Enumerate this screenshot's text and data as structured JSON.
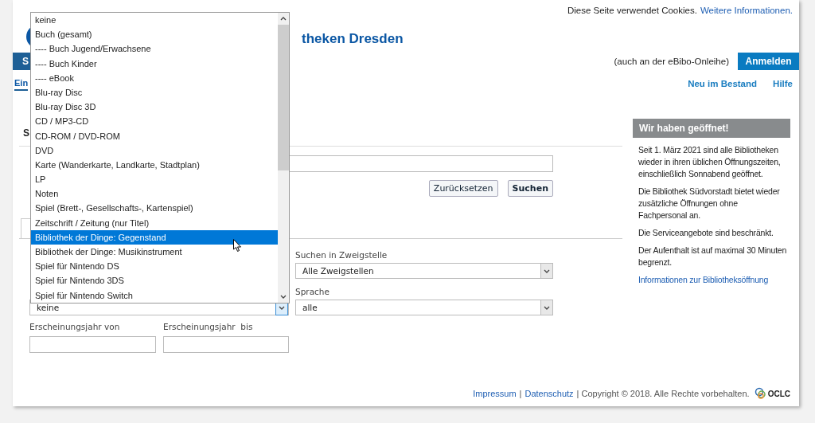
{
  "cookie_notice": {
    "text": "Diese Seite verwendet Cookies.",
    "link": "Weitere Informationen."
  },
  "site_title": "theken Dresden",
  "nav_tab": {
    "label": "S",
    "selected": true
  },
  "login_hint": "(auch an der eBibo-Onleihe)",
  "login_button": "Anmelden",
  "sub_tab": {
    "label": "Ein",
    "selected": true
  },
  "header_links": [
    "Neu im Bestand",
    "Hilfe"
  ],
  "section_heading": "S",
  "buttons": [
    {
      "label": "Zurücksetzen",
      "primary": false
    },
    {
      "label": "Suchen",
      "primary": true
    }
  ],
  "filters": [
    {
      "label": "Suchen in Zweigstelle",
      "value": "Alle Zweigstellen"
    },
    {
      "label": "Sprache",
      "value": "alle"
    }
  ],
  "media_select": {
    "value": "keine",
    "focused": true
  },
  "year_fields": [
    {
      "label": "Erscheinungsjahr von"
    },
    {
      "label": "Erscheinungsjahr  bis"
    }
  ],
  "dropdown_list": {
    "options": [
      {
        "label": "keine",
        "selected": false
      },
      {
        "label": "Buch (gesamt)",
        "selected": false
      },
      {
        "label": "---- Buch Jugend/Erwachsene",
        "selected": false
      },
      {
        "label": "---- Buch Kinder",
        "selected": false
      },
      {
        "label": "---- eBook",
        "selected": false
      },
      {
        "label": "Blu-ray Disc",
        "selected": false
      },
      {
        "label": "Blu-ray Disc 3D",
        "selected": false
      },
      {
        "label": "CD / MP3-CD",
        "selected": false
      },
      {
        "label": "CD-ROM / DVD-ROM",
        "selected": false
      },
      {
        "label": "DVD",
        "selected": false
      },
      {
        "label": "Karte (Wanderkarte, Landkarte, Stadtplan)",
        "selected": false
      },
      {
        "label": "LP",
        "selected": false
      },
      {
        "label": "Noten",
        "selected": false
      },
      {
        "label": "Spiel (Brett-, Gesellschafts-, Kartenspiel)",
        "selected": false
      },
      {
        "label": "Zeitschrift / Zeitung (nur Titel)",
        "selected": false
      },
      {
        "label": "Bibliothek der Dinge: Gegenstand",
        "selected": true
      },
      {
        "label": "Bibliothek der Dinge: Musikinstrument",
        "selected": false
      },
      {
        "label": "Spiel für Nintendo DS",
        "selected": false
      },
      {
        "label": "Spiel für Nintendo 3DS",
        "selected": false
      },
      {
        "label": "Spiel für Nintendo Switch",
        "selected": false
      }
    ]
  },
  "sidebar": {
    "title": "Wir haben geöffnet!",
    "paragraphs": [
      "Seit 1. März 2021 sind alle Bibliotheken wieder in ihren üblichen Öffnungszeiten, einschließlich Sonnabend geöffnet.",
      "Die Bibliothek Südvorstadt bietet wieder zusätzliche Öffnungen ohne Fachpersonal an.",
      "Die Serviceangebote sind beschränkt.",
      "Der Aufenthalt ist auf maximal 30 Minuten begrenzt."
    ],
    "link": "Informationen zur Bibliotheksöffnung"
  },
  "footer": {
    "items": [
      {
        "kind": "link",
        "text": "Impressum"
      },
      {
        "kind": "text",
        "text": "|"
      },
      {
        "kind": "link",
        "text": "Datenschutz"
      },
      {
        "kind": "text",
        "text": "| Copyright © 2018. Alle Rechte vorbehalten."
      }
    ],
    "logo_text": "OCLC"
  }
}
